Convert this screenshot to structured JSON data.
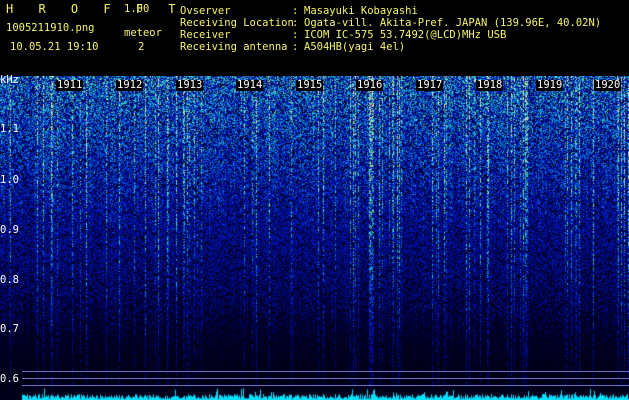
{
  "app": {
    "title": "H R O F F T",
    "version": "1.00"
  },
  "file": {
    "name": "1005211910.png",
    "datetime": "10.05.21 19:10"
  },
  "detection": {
    "label": "meteor",
    "count": "2"
  },
  "info": {
    "observer_label": "Ovserver",
    "observer": "Masayuki Kobayashi",
    "location_label": "Receiving Location",
    "location": "Ogata-vill. Akita-Pref. JAPAN (139.96E, 40.02N)",
    "receiver_label": "Receiver",
    "receiver": "ICOM IC-575 53.7492(@LCD)MHz USB",
    "antenna_label": "Receiving antenna",
    "antenna": "A504HB(yagi 4el)",
    "separator": ":"
  },
  "axis": {
    "unit": "kHz",
    "freq_ticks": [
      "1.1",
      "1.0",
      "0.9",
      "0.8",
      "0.7",
      "0.6"
    ],
    "time_ticks": [
      "1911",
      "1912",
      "1913",
      "1914",
      "1915",
      "1916",
      "1917",
      "1918",
      "1919",
      "1920"
    ]
  },
  "colors": {
    "text_header": "#f4f46a",
    "meteor_echo": "#00e0ff",
    "background": "#000000"
  }
}
